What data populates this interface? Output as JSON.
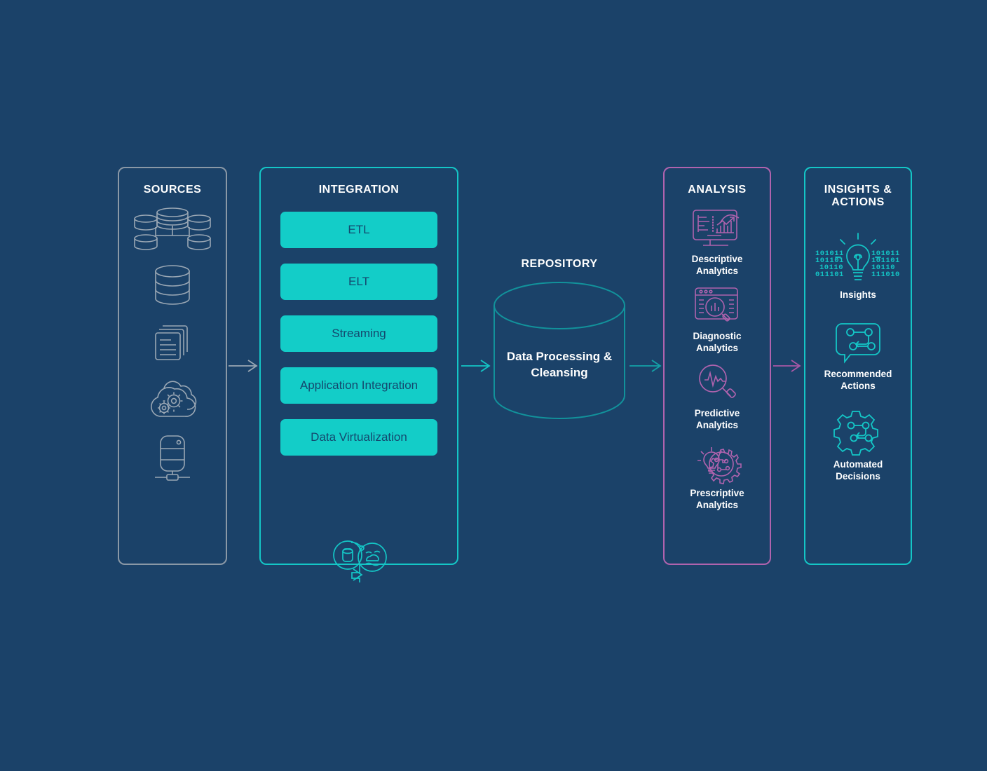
{
  "theme": {
    "background": "#1b4269",
    "gray": "#8a98a6",
    "teal": "#14c6c6",
    "teal_bright": "#13cdc8",
    "purple": "#b063ae",
    "white": "#ffffff",
    "pill_text": "#14486e"
  },
  "columns": {
    "sources": {
      "title": "SOURCES",
      "icons": [
        {
          "name": "database-cluster-icon",
          "label": "database cluster"
        },
        {
          "name": "database-icon",
          "label": "database"
        },
        {
          "name": "documents-icon",
          "label": "documents"
        },
        {
          "name": "cloud-gears-icon",
          "label": "cloud applications"
        },
        {
          "name": "server-icon",
          "label": "server"
        }
      ]
    },
    "integration": {
      "title": "INTEGRATION",
      "pills": [
        {
          "label": "ETL"
        },
        {
          "label": "ELT"
        },
        {
          "label": "Streaming"
        },
        {
          "label": "Application Integration"
        },
        {
          "label": "Data Virtualization"
        }
      ],
      "bottom_icon": "data-lake-transfer-icon"
    },
    "repository": {
      "title": "REPOSITORY",
      "label_line1": "Data Processing &",
      "label_line2": "Cleansing"
    },
    "analysis": {
      "title": "ANALYSIS",
      "items": [
        {
          "icon": "monitor-chart-icon",
          "label_line1": "Descriptive",
          "label_line2": "Analytics"
        },
        {
          "icon": "browser-magnifier-icon",
          "label_line1": "Diagnostic",
          "label_line2": "Analytics"
        },
        {
          "icon": "magnifier-pulse-icon",
          "label_line1": "Predictive",
          "label_line2": "Analytics"
        },
        {
          "icon": "lightbulb-gear-icon",
          "label_line1": "Prescriptive",
          "label_line2": "Analytics"
        }
      ]
    },
    "insights": {
      "title_line1": "INSIGHTS &",
      "title_line2": "ACTIONS",
      "items": [
        {
          "icon": "lightbulb-binary-icon",
          "label_line1": "Insights",
          "label_line2": ""
        },
        {
          "icon": "speech-bubble-flow-icon",
          "label_line1": "Recommended",
          "label_line2": "Actions"
        },
        {
          "icon": "gear-flow-icon",
          "label_line1": "Automated",
          "label_line2": "Decisions"
        }
      ]
    }
  },
  "arrows": [
    {
      "name": "arrow-sources-to-integration",
      "color": "#9aa7b4"
    },
    {
      "name": "arrow-integration-to-repository",
      "color": "#14c6c6"
    },
    {
      "name": "arrow-repository-to-analysis",
      "color": "#14a3a8"
    },
    {
      "name": "arrow-analysis-to-insights",
      "color": "#a858a6"
    }
  ],
  "binary_text": {
    "left": [
      "101011",
      "101101",
      "10110",
      "011101"
    ],
    "right": [
      "101011",
      "101101",
      "10110",
      "111010"
    ]
  }
}
